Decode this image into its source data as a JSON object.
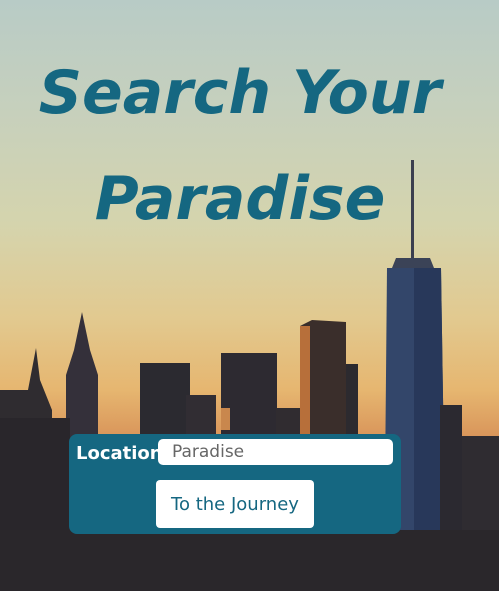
{
  "hero": {
    "title": "Search Your Paradise"
  },
  "search_form": {
    "location_label": "Location",
    "location_placeholder": "Paradise",
    "location_value": "",
    "submit_label": "To the Journey"
  },
  "colors": {
    "accent": "#156781",
    "button_bg": "#ffffff"
  }
}
